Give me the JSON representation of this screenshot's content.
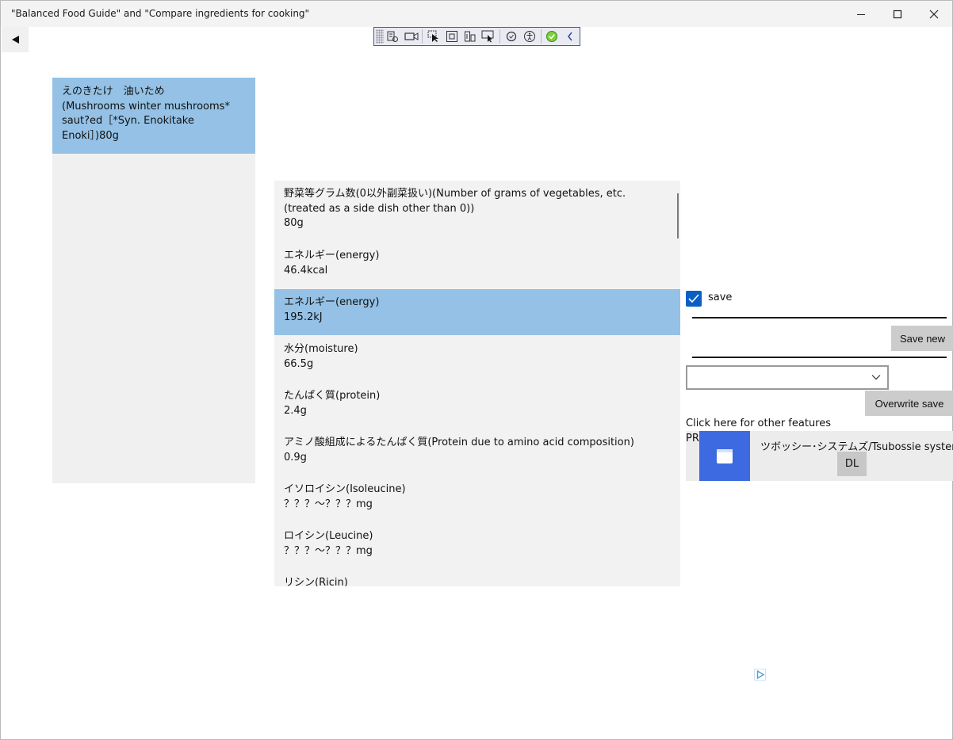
{
  "window": {
    "title": "\"Balanced Food Guide\" and \"Compare ingredients for cooking\"",
    "controls": {
      "minimize": "minimize-icon",
      "maximize": "maximize-icon",
      "close": "close-icon"
    }
  },
  "nav": {
    "back_icon": "back-arrow-icon"
  },
  "debug_toolbar": {
    "icons": [
      "grip-icon",
      "live-visual-tree-icon",
      "record-icon",
      "select-element-icon",
      "display-layout-adorners-icon",
      "track-focus-icon",
      "preview-selection-icon",
      "hot-reload-icon",
      "accessibility-icon",
      "binding-failures-icon",
      "collapse-icon"
    ]
  },
  "food": {
    "selected_label": "えのきたけ　油いため\n(Mushrooms  winter mushrooms*\nsaut?ed［*Syn. Enokitake\nEnoki］)80g"
  },
  "nutrients": [
    {
      "name": "野菜等グラム数(0以外副菜扱い)(Number of grams of vegetables, etc.\n(treated as a side dish other than 0))",
      "value": "80g",
      "selected": false
    },
    {
      "name": "エネルギー(energy)",
      "value": "46.4kcal",
      "selected": false
    },
    {
      "name": "エネルギー(energy)",
      "value": "195.2kJ",
      "selected": true
    },
    {
      "name": "水分(moisture)",
      "value": "66.5g",
      "selected": false
    },
    {
      "name": "たんぱく質(protein)",
      "value": "2.4g",
      "selected": false
    },
    {
      "name": "アミノ酸組成によるたんぱく質(Protein due to amino acid composition)",
      "value": "0.9g",
      "selected": false
    },
    {
      "name": "イソロイシン(Isoleucine)",
      "value": "？？？～？？？mg",
      "selected": false
    },
    {
      "name": "ロイシン(Leucine)",
      "value": "？？？～？？？mg",
      "selected": false
    },
    {
      "name": "リシン(Ricin)",
      "value": "",
      "selected": false
    }
  ],
  "controls": {
    "save_checked": true,
    "save_label": "save",
    "save_new_label": "Save new",
    "combo_value": "",
    "overwrite_save_label": "Overwrite save",
    "other_features_label": "Click here for other features"
  },
  "ad": {
    "pr_label": "PR",
    "app_title": "ツボッシー･システムズ/Tsubossie systems",
    "download_label": "DL",
    "app_icon": "window-app-icon",
    "ad_choices_icon": "adchoices-icon"
  },
  "colors": {
    "selection": "#94c1e5",
    "panel_bg": "#f0f0f0",
    "checkbox": "#0a5fc4",
    "ad_icon_bg": "#3d6ae0",
    "button_bg": "#cccccc"
  }
}
